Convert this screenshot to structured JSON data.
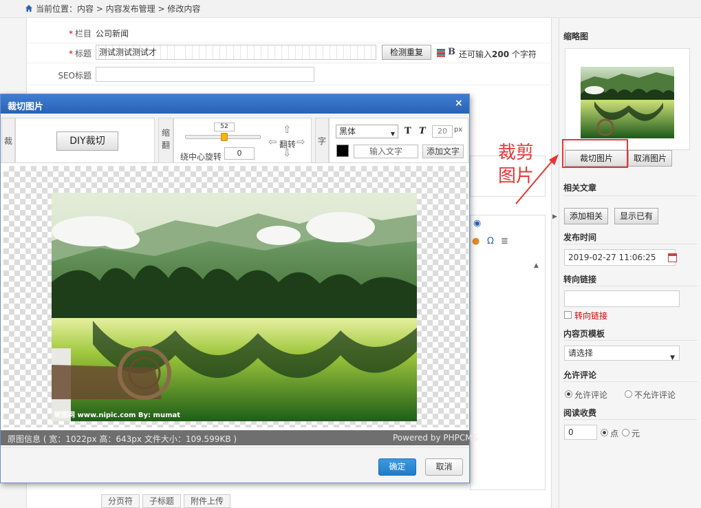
{
  "breadcrumb": {
    "text": "当前位置：内容 > 内容发布管理 > 修改内容"
  },
  "form": {
    "category_label": "栏目",
    "category_value": "公司新闻",
    "title_label": "标题",
    "title_value": "测试测试测试才",
    "check_duplicate_button": "检测重复",
    "remaining_prefix": "还可输入",
    "remaining_count": "200",
    "remaining_suffix": "个字符",
    "seo_title_label": "SEO标题"
  },
  "bottom_tabs": [
    "分页符",
    "子标题",
    "附件上传"
  ],
  "sidebar": {
    "thumbnail_heading": "缩略图",
    "crop_image_button": "裁切图片",
    "cancel_image_button": "取消图片",
    "related_heading": "相关文章",
    "add_related_button": "添加相关",
    "show_existing_button": "显示已有",
    "publish_time_heading": "发布时间",
    "publish_time_value": "2019-02-27 11:06:25",
    "redirect_heading": "转向链接",
    "redirect_checkbox_label": "转向链接",
    "template_heading": "内容页模板",
    "template_select_value": "请选择",
    "comment_heading": "允许评论",
    "allow_comment_label": "允许评论",
    "disallow_comment_label": "不允许评论",
    "read_fee_heading": "阅读收费",
    "read_fee_value": "0",
    "point_label": "点",
    "yuan_label": "元"
  },
  "annotation": {
    "line1": "裁剪",
    "line2": "图片"
  },
  "dialog": {
    "title": "裁切图片",
    "crop_tag": "裁",
    "diy_crop_button": "DIY裁切",
    "scale_tag": "缩翻",
    "slider_value": "52",
    "rotate_center_label": "绕中心旋转",
    "rotate_value": "0",
    "flip_label": "翻转",
    "text_tag": "字",
    "font_select_value": "黑体",
    "font_size_value": "20",
    "px_unit": "px",
    "text_input_placeholder": "输入文字",
    "add_text_button": "添加文字",
    "image_info": "原图信息 ( 宽：1022px  高：643px  文件大小：109.599KB )",
    "powered_by": "Powered by PHPCMS",
    "ok_button": "确定",
    "cancel_button": "取消"
  },
  "colors": {
    "accent_red": "#e63535",
    "dialog_title_blue": "#3f7dd1",
    "ok_blue": "#1f7cc7"
  }
}
